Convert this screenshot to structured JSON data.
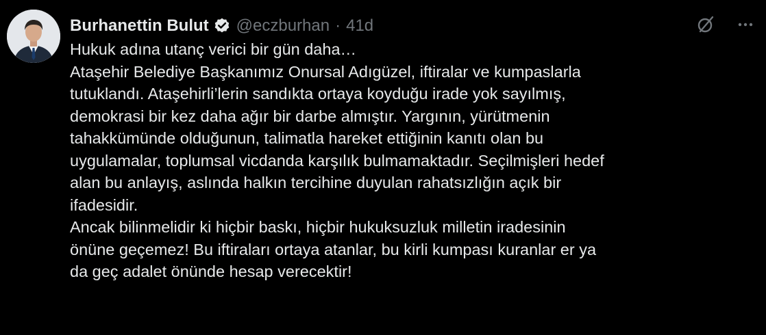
{
  "author": {
    "display_name": "Burhanettin Bulut",
    "handle": "@eczburhan",
    "separator": "·",
    "time": "41d",
    "verified": true
  },
  "icons": {
    "verified": "verified-badge-icon",
    "grok": "grok-icon",
    "more": "more-icon"
  },
  "colors": {
    "background": "#000000",
    "text": "#e7e9ea",
    "muted": "#71767b",
    "verified_badge": "#e7e9ea"
  },
  "tweet": {
    "lines": [
      "Hukuk adına utanç verici bir gün daha…",
      "Ataşehir Belediye Başkanımız Onursal Adıgüzel, iftiralar ve  kumpaslarla",
      "tutuklandı. Ataşehirli’lerin sandıkta ortaya koyduğu irade yok sayılmış,",
      "demokrasi bir kez daha ağır bir darbe almıştır. Yargının, yürütmenin",
      "tahakkümünde olduğunun, talimatla hareket ettiğinin kanıtı olan bu",
      "uygulamalar, toplumsal vicdanda karşılık bulmamaktadır. Seçilmişleri hedef",
      "alan bu anlayış, aslında halkın tercihine duyulan rahatsızlığın açık bir",
      "ifadesidir.",
      "Ancak bilinmelidir ki hiçbir baskı, hiçbir hukuksuzluk milletin iradesinin",
      "önüne geçemez! Bu iftiraları ortaya atanlar, bu kirli kumpası kuranlar er ya",
      "da geç adalet önünde hesap verecektir!"
    ]
  }
}
